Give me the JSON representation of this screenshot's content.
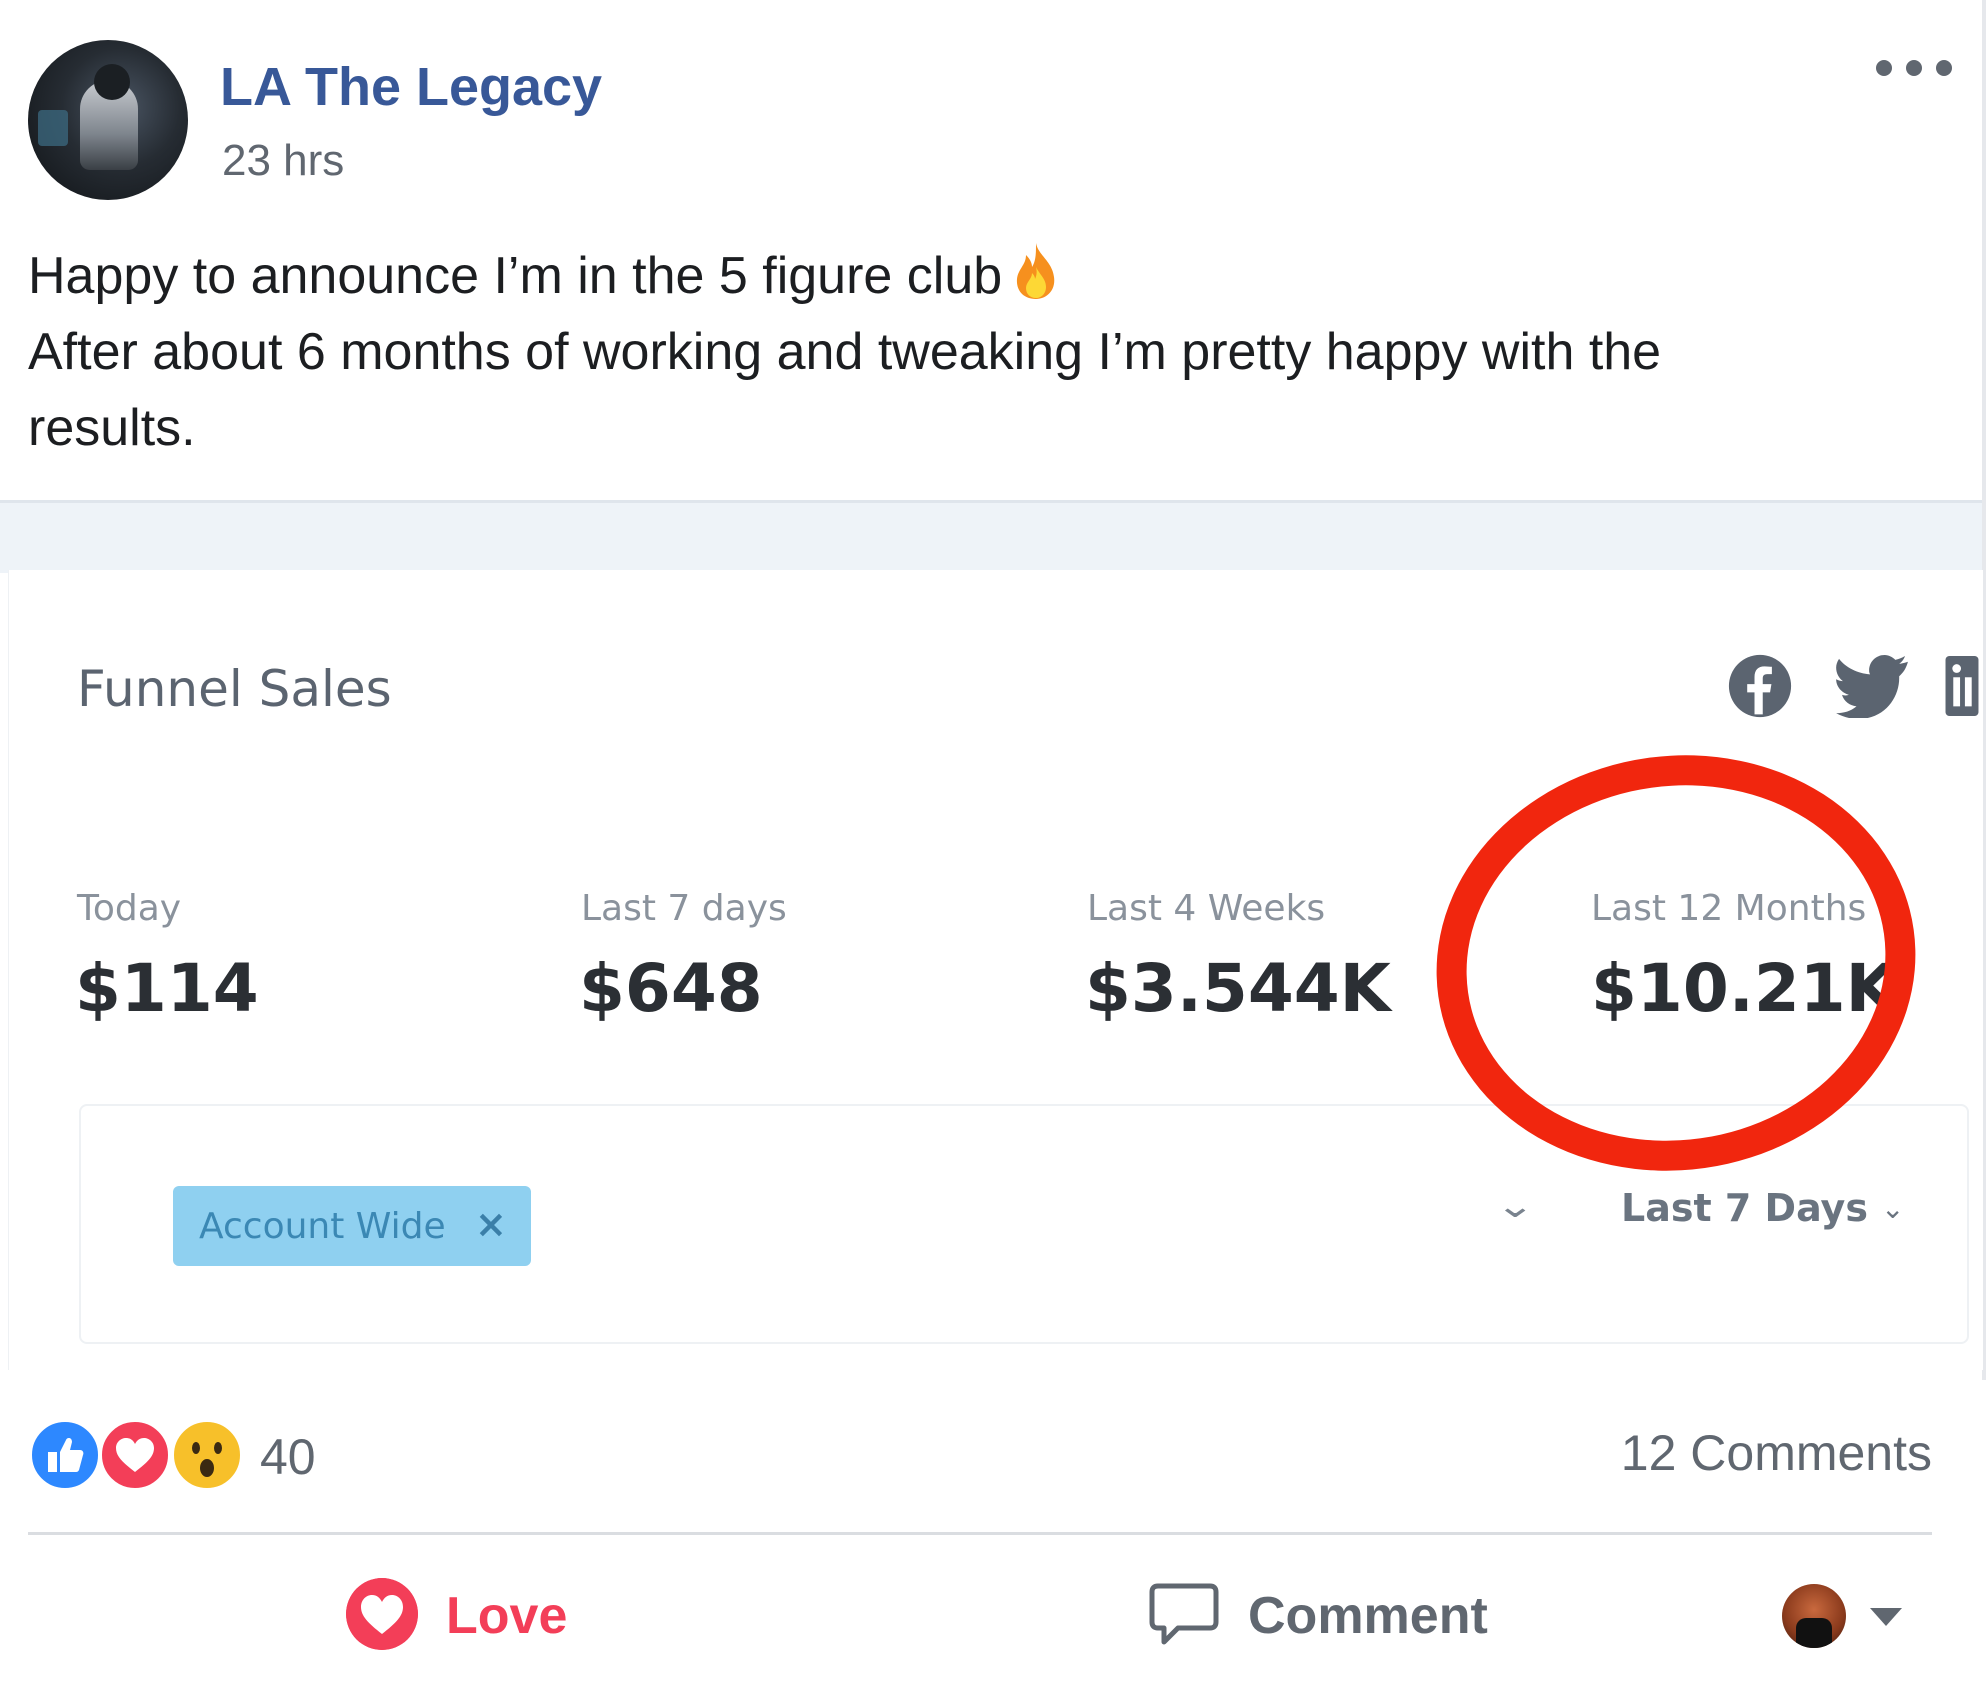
{
  "post": {
    "author": "LA The Legacy",
    "time": "23 hrs",
    "text_lines": [
      "Happy to announce I’m in the 5 figure club",
      "After about 6 months of working and tweaking I’m pretty happy with the",
      "results."
    ],
    "emoji": "fire-emoji"
  },
  "funnel": {
    "title": "Funnel Sales",
    "social_icons": [
      "facebook-icon",
      "twitter-icon",
      "linkedin-icon"
    ],
    "stats": [
      {
        "label": "Today",
        "value": "$114"
      },
      {
        "label": "Last 7 days",
        "value": "$648"
      },
      {
        "label": "Last 4 Weeks",
        "value": "$3.544K"
      },
      {
        "label": "Last 12 Months",
        "value": "$10.21K"
      }
    ],
    "filter_chip": "Account Wide",
    "chip_close": "×",
    "range": "Last 7 Days",
    "highlight_color": "#f1260e"
  },
  "engagement": {
    "reaction_icons": [
      "like-icon",
      "love-icon",
      "wow-icon"
    ],
    "reaction_count": "40",
    "comments": "12 Comments"
  },
  "actions": {
    "love": "Love",
    "comment": "Comment"
  },
  "colors": {
    "author": "#385898",
    "love": "#f33e58",
    "like": "#2d88ff"
  }
}
